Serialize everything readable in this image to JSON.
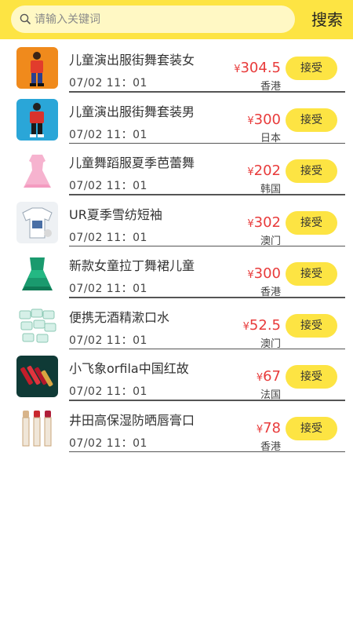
{
  "search": {
    "placeholder": "请输入关键词",
    "button_label": "搜索"
  },
  "colors": {
    "accent": "#fde443",
    "price": "#e83b3b"
  },
  "items": [
    {
      "title": "儿童演出服街舞套装女",
      "time": "07/02 11：01",
      "currency": "¥",
      "price": "304.5",
      "origin": "香港",
      "action": "接受",
      "thumb": "girl-costume"
    },
    {
      "title": "儿童演出服街舞套装男",
      "time": "07/02 11：01",
      "currency": "¥",
      "price": "300",
      "origin": "日本",
      "action": "接受",
      "thumb": "boy-costume"
    },
    {
      "title": "儿童舞蹈服夏季芭蕾舞",
      "time": "07/02 11：01",
      "currency": "¥",
      "price": "202",
      "origin": "韩国",
      "action": "接受",
      "thumb": "pink-ballet-dress"
    },
    {
      "title": "UR夏季雪纺短袖",
      "time": "07/02 11：01",
      "currency": "¥",
      "price": "302",
      "origin": "澳门",
      "action": "接受",
      "thumb": "chiffon-tee"
    },
    {
      "title": "新款女童拉丁舞裙儿童",
      "time": "07/02 11：01",
      "currency": "¥",
      "price": "300",
      "origin": "香港",
      "action": "接受",
      "thumb": "green-latin-dress"
    },
    {
      "title": "便携无酒精漱口水",
      "time": "07/02 11：01",
      "currency": "¥",
      "price": "52.5",
      "origin": "澳门",
      "action": "接受",
      "thumb": "mouthwash-packs"
    },
    {
      "title": "小飞象orfila中国红故",
      "time": "07/02 11：01",
      "currency": "¥",
      "price": "67",
      "origin": "法国",
      "action": "接受",
      "thumb": "lipstick-set"
    },
    {
      "title": "井田高保湿防晒唇膏口",
      "time": "07/02 11：01",
      "currency": "¥",
      "price": "78",
      "origin": "香港",
      "action": "接受",
      "thumb": "lip-balm"
    }
  ]
}
